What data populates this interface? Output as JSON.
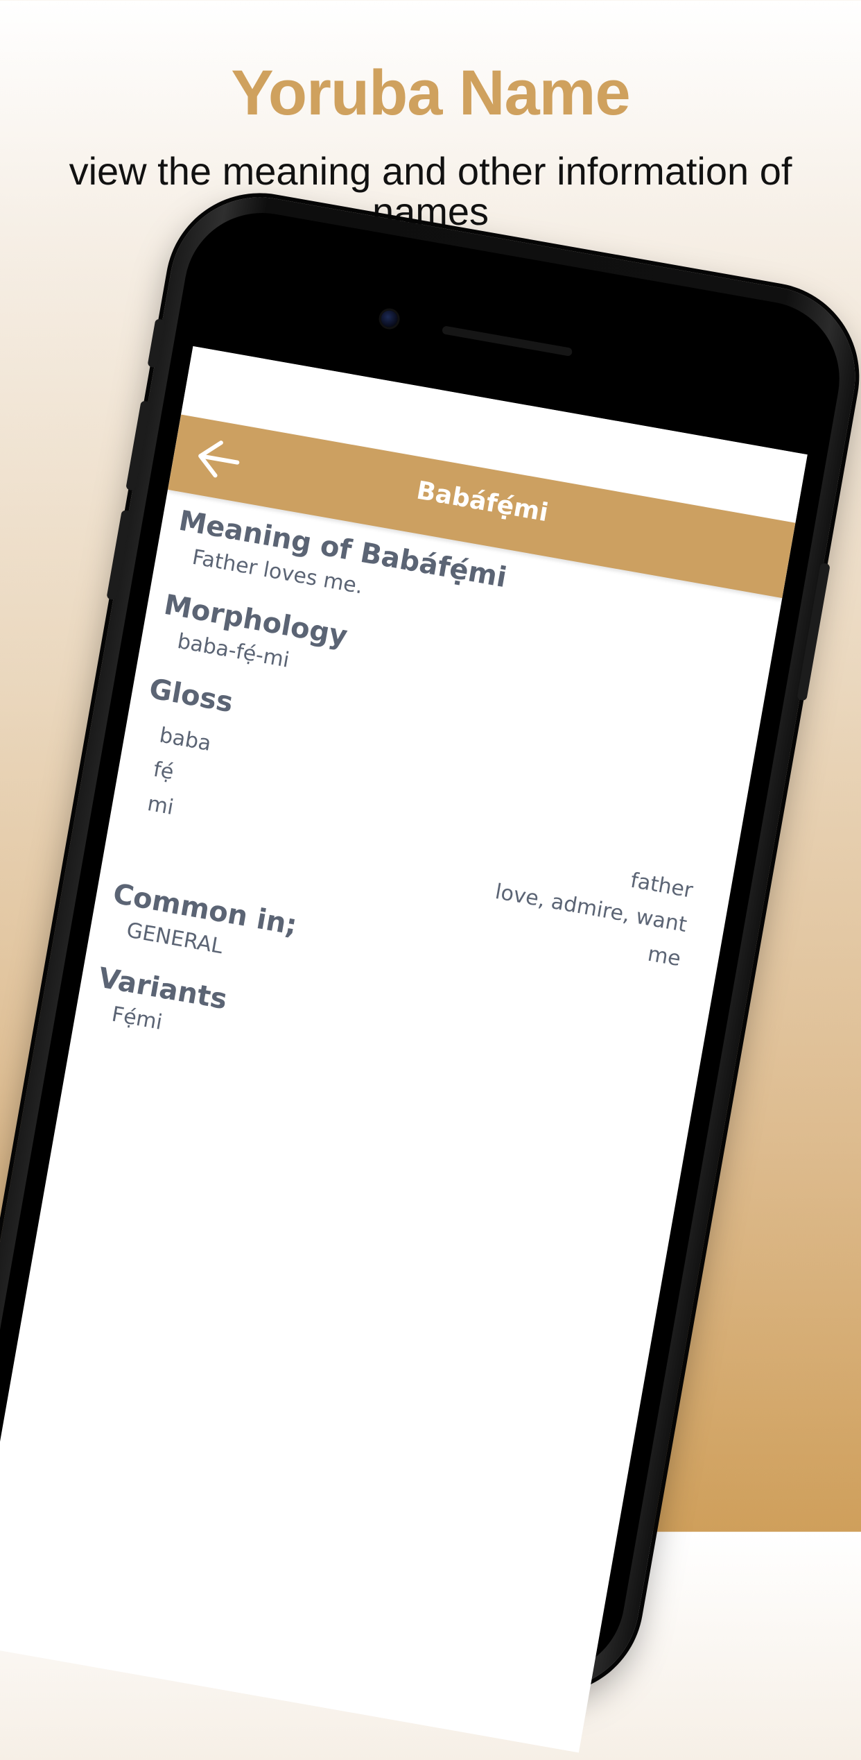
{
  "promo": {
    "title": "Yoruba Name",
    "subtitle": "view the meaning and other information of names"
  },
  "app_bar": {
    "back_icon": "arrow-left-icon",
    "title": "Babáfẹ́mi"
  },
  "sections": {
    "meaning": {
      "title": "Meaning of Babáfẹ́mi",
      "value": "Father loves me."
    },
    "morphology": {
      "title": "Morphology",
      "value": "baba-fẹ́-mi"
    },
    "gloss": {
      "title": "Gloss",
      "words": [
        "baba",
        "fẹ́",
        "mi"
      ],
      "meanings": [
        "father",
        "love, admire, want",
        "me"
      ]
    },
    "common_in": {
      "title": "Common in;",
      "value": "GENERAL"
    },
    "variants": {
      "title": "Variants",
      "value": "Fẹ́mi"
    }
  },
  "colors": {
    "accent": "#cca061",
    "text": "#5b6474",
    "title_gold": "#cfa15e"
  }
}
